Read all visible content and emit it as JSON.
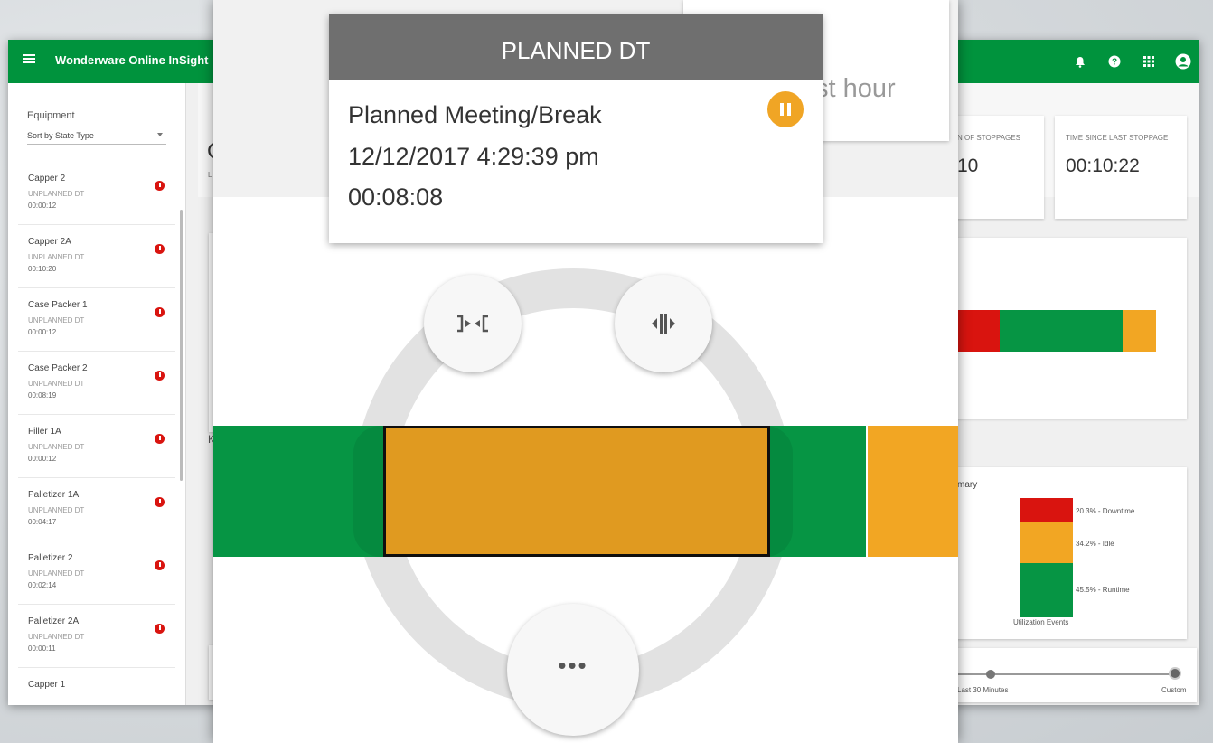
{
  "app": {
    "title": "Wonderware Online InSight",
    "colors": {
      "brand_green": "#00933d",
      "downtime_red": "#d9140f",
      "idle_orange": "#f2a623",
      "runtime_green": "#069544"
    },
    "icons": [
      "menu-icon",
      "bell-icon",
      "help-icon",
      "apps-grid-icon",
      "account-icon"
    ]
  },
  "sidebar": {
    "label": "Equipment",
    "sort_value": "Sort by State Type",
    "items": [
      {
        "name": "Capper 2",
        "state": "UNPLANNED DT",
        "duration": "00:00:12"
      },
      {
        "name": "Capper 2A",
        "state": "UNPLANNED DT",
        "duration": "00:10:20"
      },
      {
        "name": "Case Packer 1",
        "state": "UNPLANNED DT",
        "duration": "00:00:12"
      },
      {
        "name": "Case Packer 2",
        "state": "UNPLANNED DT",
        "duration": "00:08:19"
      },
      {
        "name": "Filler 1A",
        "state": "UNPLANNED DT",
        "duration": "00:00:12"
      },
      {
        "name": "Palletizer 1A",
        "state": "UNPLANNED DT",
        "duration": "00:04:17"
      },
      {
        "name": "Palletizer 2",
        "state": "UNPLANNED DT",
        "duration": "00:02:14"
      },
      {
        "name": "Palletizer 2A",
        "state": "UNPLANNED DT",
        "duration": "00:00:11"
      },
      {
        "name": "Capper 1",
        "state": "",
        "duration": ""
      }
    ]
  },
  "main": {
    "partial_left_letter": "C",
    "partial_left_sub": "L",
    "partial_k_label": "K",
    "kpis": [
      {
        "title": "N OF STOPPAGES",
        "value": "10"
      },
      {
        "title": "TIME SINCE LAST STOPPAGE",
        "value": "00:10:22"
      }
    ],
    "summary": {
      "title_partial": "mary",
      "caption": "Utilization Events",
      "segments": [
        {
          "label": "20.3% - Downtime",
          "percent": 20.3
        },
        {
          "label": "34.2% - Idle",
          "percent": 34.2
        },
        {
          "label": "45.5% - Runtime",
          "percent": 45.5
        }
      ]
    },
    "time_slider": {
      "label_left": "Last 30 Minutes",
      "label_right": "Custom"
    }
  },
  "overlay": {
    "bg_card_text": "st hour",
    "popup": {
      "title": "PLANNED DT",
      "reason": "Planned Meeting/Break",
      "timestamp": "12/12/2017 4:29:39 pm",
      "duration": "00:08:08"
    },
    "more_label": "•••"
  }
}
